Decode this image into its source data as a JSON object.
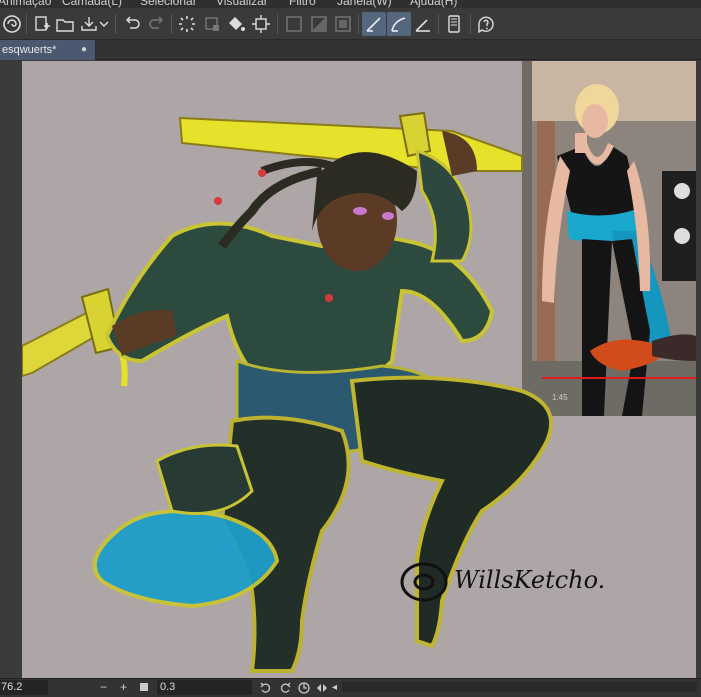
{
  "menu": {
    "items": [
      "Animação",
      "Camada(L)",
      "Selecionar",
      "Visualizar",
      "Filtro",
      "Janela(W)",
      "Ajuda(H)"
    ]
  },
  "toolbar": {
    "icons": [
      "logo-icon",
      "new-document-icon",
      "open-folder-icon",
      "save-icon",
      "undo-icon",
      "redo-icon",
      "loading-spinner-icon",
      "clear-layer-icon",
      "fill-icon",
      "transform-icon",
      "deselect-icon",
      "invert-selection-icon",
      "selection-border-icon",
      "snap-ruler-icon",
      "snap-special-ruler-icon",
      "snap-grid-icon",
      "device-icon",
      "help-icon"
    ]
  },
  "tab": {
    "title": "esqwuerts*",
    "close_glyph": "●"
  },
  "canvas": {
    "signature_text": "WillsKetcho.",
    "reference_timestamp": "1:45"
  },
  "status": {
    "zoom": "76.2",
    "minus": "−",
    "plus": "+",
    "angle": "0.3",
    "left_arrow": "◂"
  },
  "colors": {
    "accent": "#55677f",
    "canvas_bg": "#aea6a6",
    "sword_yellow": "#e6e12a",
    "sash_blue": "#1e9ec9",
    "red_line": "#e11b1b"
  }
}
